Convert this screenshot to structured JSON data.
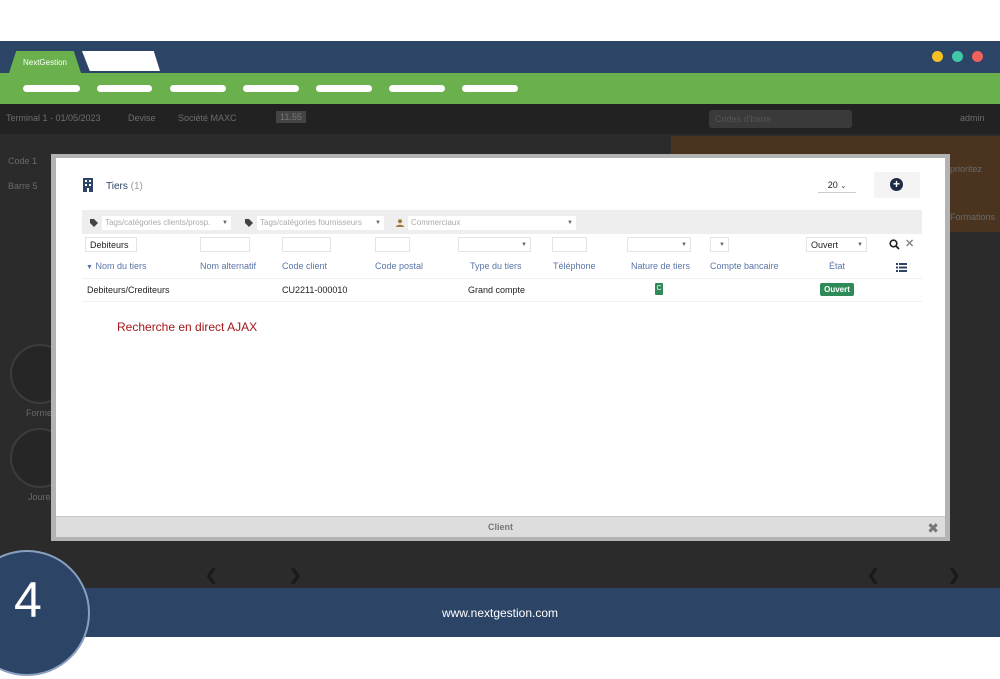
{
  "browser": {
    "active_tab": "NextGestion",
    "window_dots": [
      "#f5c026",
      "#3fc7a8",
      "#f0605c"
    ]
  },
  "app_background": {
    "terminal": "Terminal 1 - 01/05/2023",
    "currency": "Devise",
    "company": "Société MAXC",
    "amount": "11.55",
    "search_placeholder": "Codes d'barre",
    "user": "admin",
    "left_label": "Code 1",
    "left_label2": "Barre 5",
    "right_label": "prioritez",
    "right_label2": "Formations",
    "side_labels": [
      "Forme",
      "Joure"
    ]
  },
  "modal": {
    "title": "Tiers",
    "count": "(1)",
    "page_size": "20",
    "tag_filters": {
      "clients_placeholder": "Tags/catégories clients/prosp.",
      "suppliers_placeholder": "Tags/catégories fournisseurs",
      "sales_placeholder": "Commerciaux"
    },
    "filter_values": {
      "name": "Debiteurs",
      "state": "Ouvert"
    },
    "columns": [
      "Nom du tiers",
      "Nom alternatif",
      "Code client",
      "Code postal",
      "Type du tiers",
      "Téléphone",
      "Nature de tiers",
      "Compte bancaire",
      "État"
    ],
    "rows": [
      {
        "name": "Debiteurs/Crediteurs",
        "alt_name": "",
        "client_code": "CU2211-000010",
        "postal_code": "",
        "type": "Grand compte",
        "phone": "",
        "nature": "C",
        "bank": "",
        "state": "Ouvert"
      }
    ],
    "note": "Recherche en direct AJAX",
    "footer_label": "Client"
  },
  "site": {
    "url": "www.nextgestion.com",
    "step": "4"
  },
  "colors": {
    "navy": "#2c4466",
    "green": "#6ab04c",
    "badge_green": "#2e8b57",
    "note_red": "#a4161a"
  },
  "icons": [
    "building-icon",
    "tag-icon",
    "user-icon",
    "plus-circle-icon",
    "search-icon",
    "close-icon",
    "list-icon",
    "sort-down-icon",
    "chevron-left-icon",
    "chevron-right-icon"
  ]
}
